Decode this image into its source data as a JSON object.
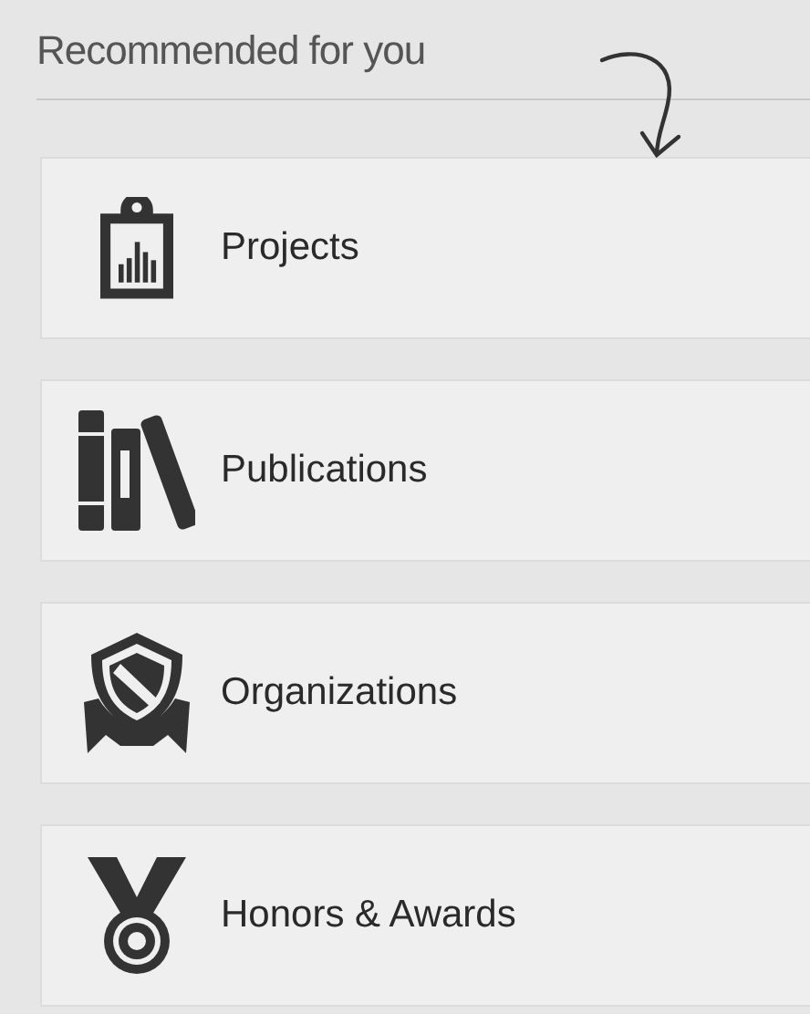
{
  "heading": "Recommended for you",
  "items": [
    {
      "kind": "projects",
      "label": "Projects"
    },
    {
      "kind": "publications",
      "label": "Publications"
    },
    {
      "kind": "organizations",
      "label": "Organizations"
    },
    {
      "kind": "awards",
      "label": "Honors & Awards"
    }
  ]
}
